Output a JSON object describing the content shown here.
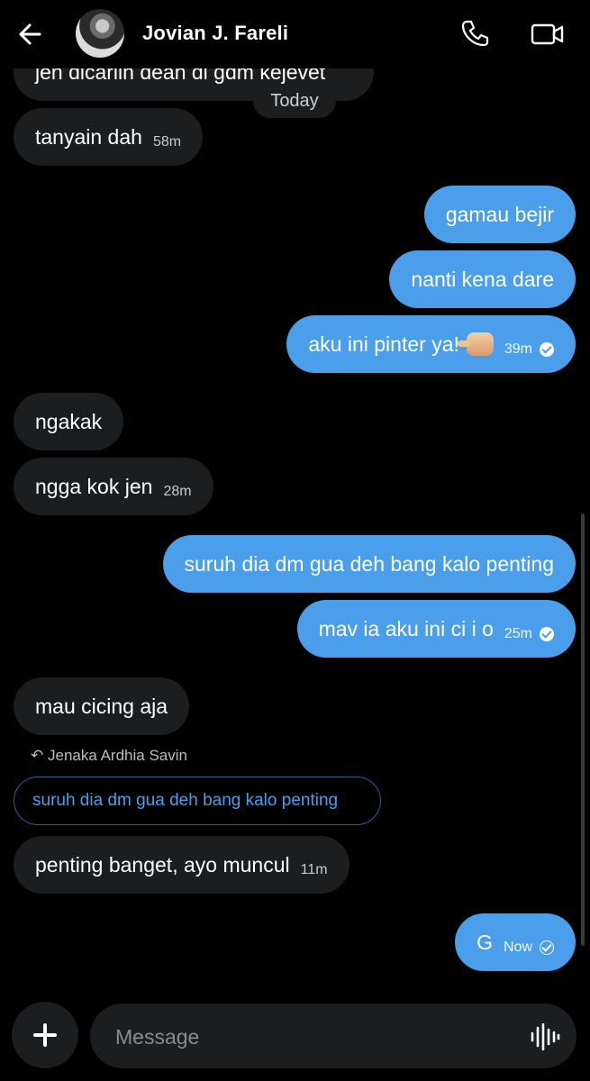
{
  "header": {
    "contact_name": "Jovian J. Fareli",
    "icons": [
      "back-arrow-icon",
      "avatar",
      "phone-icon",
      "video-camera-icon"
    ]
  },
  "date_separator": "Today",
  "messages": [
    {
      "direction": "in",
      "text": "jen dicariin dean di gdm kejevet"
    },
    {
      "direction": "in",
      "text": "tanyain dah",
      "time": "58m"
    },
    {
      "direction": "out",
      "text": "gamau bejir"
    },
    {
      "direction": "out",
      "text": "nanti kena dare"
    },
    {
      "direction": "out",
      "text": "aku ini pinter ya!",
      "emoji": "pointing-fist-emoji",
      "time": "39m",
      "status": "read"
    },
    {
      "direction": "in",
      "text": "ngakak"
    },
    {
      "direction": "in",
      "text": "ngga kok jen",
      "time": "28m"
    },
    {
      "direction": "out",
      "text": "suruh dia dm gua deh bang kalo penting"
    },
    {
      "direction": "out",
      "text": "mav ia aku ini ci i o",
      "time": "25m",
      "status": "read"
    },
    {
      "direction": "in",
      "text": "mau cicing aja"
    },
    {
      "direction": "in",
      "reply_to_author": "Jenaka Ardhia Savin",
      "reply_to_text": "suruh dia dm gua deh bang kalo penting",
      "text": "penting banget, ayo muncul",
      "time": "11m"
    },
    {
      "direction": "out",
      "text": "G",
      "time": "Now",
      "status": "sent"
    }
  ],
  "composer": {
    "placeholder": "Message",
    "value": ""
  },
  "colors": {
    "background": "#000000",
    "incoming_bubble": "#1c1d1f",
    "outgoing_bubble": "#4a9eea",
    "accent": "#4a9eea"
  }
}
